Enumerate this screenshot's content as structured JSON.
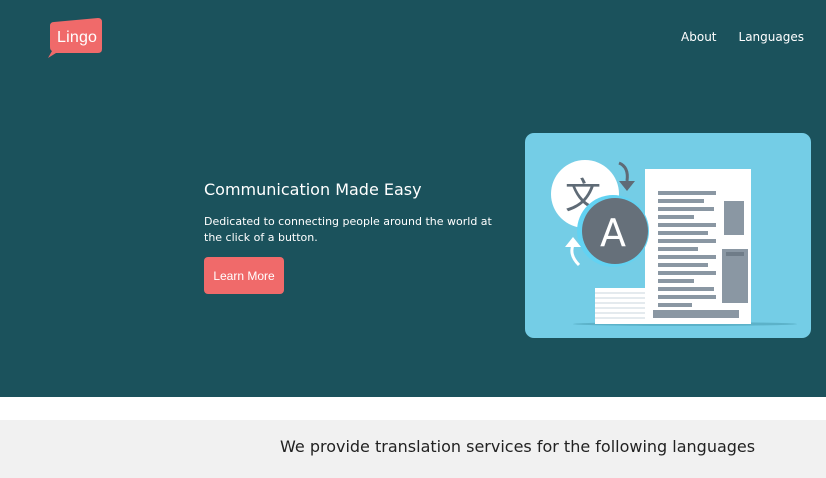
{
  "brand": {
    "name": "Lingo",
    "color": "#f06a6a"
  },
  "nav": {
    "about": "About",
    "languages": "Languages"
  },
  "hero": {
    "title": "Communication Made Easy",
    "description": "Dedicated to connecting people around the world at the click of a button.",
    "cta_label": "Learn More",
    "background": "#1b525c",
    "illustration_icon": "translation-illustration",
    "illustration_letter": "A",
    "illustration_glyph": "文"
  },
  "languages_section": {
    "heading": "We provide translation services for the following languages"
  }
}
